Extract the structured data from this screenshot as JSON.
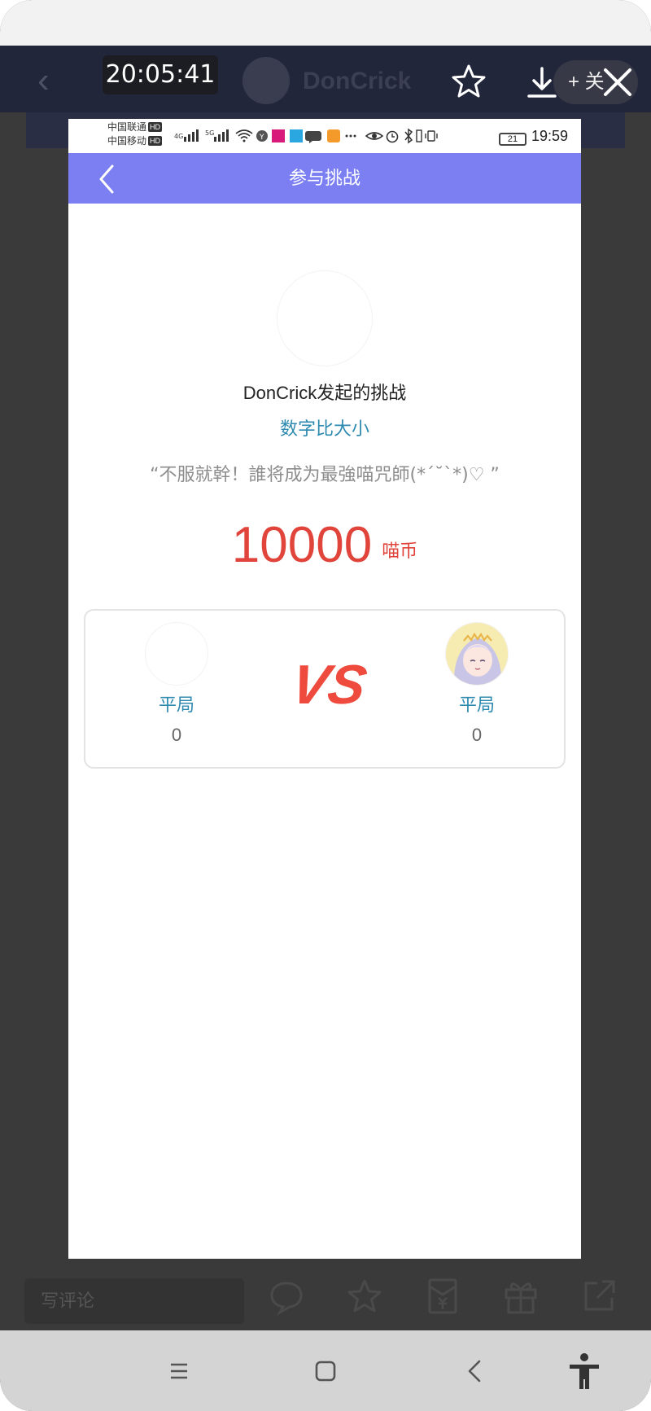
{
  "recording": {
    "timer": "20:05:41"
  },
  "background_app": {
    "username": "DonCrick",
    "follow_label": "+ 关",
    "comment_placeholder": "写评论"
  },
  "statusbar": {
    "carrier1": "中国联通",
    "carrier2": "中国移动",
    "hd": "HD",
    "net1": "4G",
    "net2": "5G",
    "battery": "21",
    "time": "19:59"
  },
  "appbar": {
    "title": "参与挑战"
  },
  "challenge": {
    "title": "DonCrick发起的挑战",
    "game": "数字比大小",
    "slogan": "“不服就幹！誰将成为最強喵咒師(*´˘`*)♡ ”",
    "amount": "10000",
    "unit": "喵币"
  },
  "match": {
    "vs": "VS",
    "left": {
      "result": "平局",
      "score": "0"
    },
    "right": {
      "result": "平局",
      "score": "0"
    }
  },
  "colors": {
    "appbar": "#7b7ff2",
    "accent_blue": "#2f8ab0",
    "stake_red": "#e0443a",
    "vs_red": "#ee4b3e"
  }
}
